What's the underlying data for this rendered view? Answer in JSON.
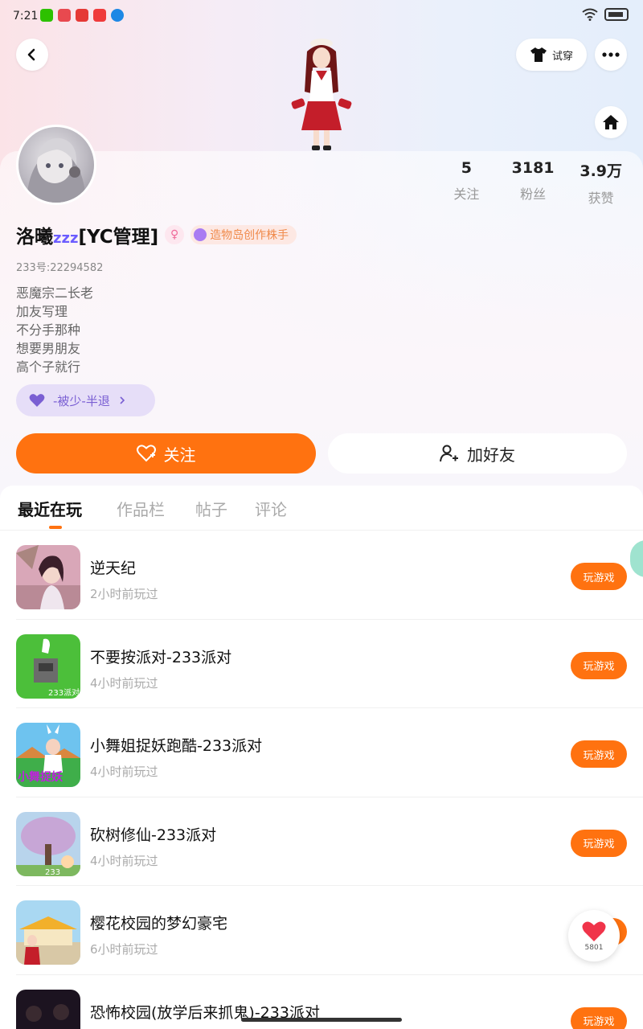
{
  "status_bar": {
    "time": "7:21"
  },
  "header": {
    "try_on_label": "试穿"
  },
  "profile": {
    "name": "洛曦",
    "name_suffix": "[YC管理]",
    "zzz": "zzz",
    "gender_symbol": "♀",
    "creator_badge": "造物岛创作株手",
    "uid": "233号:22294582",
    "bio": [
      "恶魔宗二长老",
      "加友写理",
      "不分手那种",
      "想要男朋友",
      "高个子就行"
    ],
    "family_chip": "-被少-半退"
  },
  "stats": [
    {
      "value": "5",
      "label": "关注"
    },
    {
      "value": "3181",
      "label": "粉丝"
    },
    {
      "value": "3.9万",
      "label": "获赞"
    }
  ],
  "actions": {
    "follow": "关注",
    "add_friend": "加好友"
  },
  "tabs": [
    "最近在玩",
    "作品栏",
    "帖子",
    "评论"
  ],
  "games": [
    {
      "title": "逆天纪",
      "time": "2小时前玩过",
      "button": "玩游戏"
    },
    {
      "title": "不要按派对-233派对",
      "time": "4小时前玩过",
      "button": "玩游戏"
    },
    {
      "title": "小舞姐捉妖跑酷-233派对",
      "time": "4小时前玩过",
      "button": "玩游戏"
    },
    {
      "title": "砍树修仙-233派对",
      "time": "4小时前玩过",
      "button": "玩游戏"
    },
    {
      "title": "樱花校园的梦幻豪宅",
      "time": "6小时前玩过",
      "button": "玩游戏"
    },
    {
      "title": "恐怖校园(放学后来抓鬼)-233派对",
      "time": "",
      "button": "玩游戏"
    }
  ],
  "game_icon_labels": {
    "g2": "233派对",
    "g3": "小舞捉妖",
    "g4": "233"
  },
  "float_like": {
    "count": "5801"
  }
}
